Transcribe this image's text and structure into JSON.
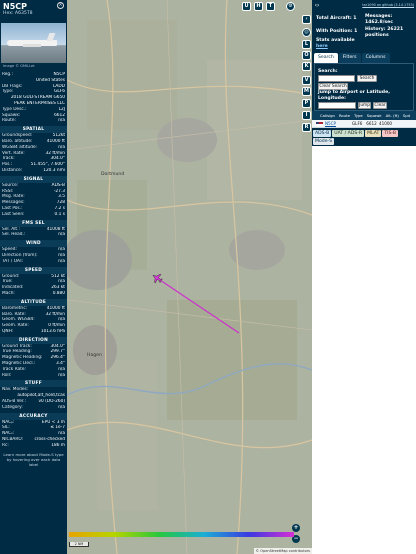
{
  "aircraft": {
    "callsign": "N5CP",
    "hex_label": "Hex: A635T8",
    "photo_credit": "Image © GMILLet"
  },
  "details": [
    {
      "k": "Reg.:",
      "v": "N5CP"
    },
    {
      "k": "",
      "v": "United States"
    },
    {
      "k": "DB Flags:",
      "v": "LADD"
    },
    {
      "k": "Type:",
      "v": "GLF6"
    },
    {
      "k": "",
      "v": "2018 GULFSTREAM G650"
    },
    {
      "k": "",
      "v": "PEAK ENTERPRISES LLC"
    },
    {
      "k": "Type Desc.:",
      "v": "L2J"
    },
    {
      "k": "Squawk:",
      "v": "6612"
    },
    {
      "k": "Route:",
      "v": "n/a"
    }
  ],
  "sections": {
    "spatial": {
      "title": "SPATIAL",
      "rows": [
        {
          "k": "Groundspeed:",
          "v": "512kt"
        },
        {
          "k": "Baro. altitude:",
          "v": "41000 ft"
        },
        {
          "k": "WGS84 altitude:",
          "v": "n/a"
        },
        {
          "k": "Vert. Rate:",
          "v": "32 ft/min"
        },
        {
          "k": "Track:",
          "v": "304.0°"
        },
        {
          "k": "Pos.:",
          "v": "51.455°, 7.600°"
        },
        {
          "k": "Distance:",
          "v": "120.3 nmi"
        }
      ]
    },
    "signal": {
      "title": "SIGNAL",
      "rows": [
        {
          "k": "Source:",
          "v": "ADS-B"
        },
        {
          "k": "RSSI:",
          "v": "-27.3"
        },
        {
          "k": "Msg. Rate:",
          "v": "3.5"
        },
        {
          "k": "Messages:",
          "v": "728"
        },
        {
          "k": "Last Pos.:",
          "v": "7.2 s"
        },
        {
          "k": "Last Seen:",
          "v": "0.1 s"
        }
      ]
    },
    "fms": {
      "title": "FMS SEL",
      "rows": [
        {
          "k": "Sel. Alt.:",
          "v": "41008 ft"
        },
        {
          "k": "Sel. Head.:",
          "v": "n/a"
        }
      ]
    },
    "wind": {
      "title": "WIND",
      "rows": [
        {
          "k": "Speed:",
          "v": "n/a"
        },
        {
          "k": "Direction (from):",
          "v": "n/a"
        },
        {
          "k": "TAT / OAT:",
          "v": "n/a"
        }
      ]
    },
    "speed": {
      "title": "SPEED",
      "rows": [
        {
          "k": "Ground:",
          "v": "512 kt"
        },
        {
          "k": "True:",
          "v": "n/a"
        },
        {
          "k": "Indicated:",
          "v": "263 kt"
        },
        {
          "k": "Mach:",
          "v": "0.880"
        }
      ]
    },
    "altitude": {
      "title": "ALTITUDE",
      "rows": [
        {
          "k": "Barometric:",
          "v": "41000 ft"
        },
        {
          "k": "Baro. Rate:",
          "v": "32 ft/min"
        },
        {
          "k": "Geom. WGS84:",
          "v": "n/a"
        },
        {
          "k": "Geom. Rate:",
          "v": "0 ft/min"
        },
        {
          "k": "QNH:",
          "v": "1013.6 hPa"
        }
      ]
    },
    "direction": {
      "title": "DIRECTION",
      "rows": [
        {
          "k": "Ground Track:",
          "v": "304.0°"
        },
        {
          "k": "True Heading:",
          "v": "299.7°"
        },
        {
          "k": "Magnetic Heading:",
          "v": "296.4°"
        },
        {
          "k": "Magnetic Decl.:",
          "v": "3.4°"
        },
        {
          "k": "Track Rate:",
          "v": "n/a"
        },
        {
          "k": "Roll:",
          "v": "n/a"
        }
      ]
    },
    "stuff": {
      "title": "STUFF",
      "rows": [
        {
          "k": "Nav. Modes:",
          "v": ""
        },
        {
          "k": "",
          "v": "autopilot,alt_hold,tcas"
        },
        {
          "k": "ADS-B Ver.:",
          "v": "v0 (DO-260)"
        },
        {
          "k": "Category:",
          "v": "n/a"
        }
      ]
    },
    "accuracy": {
      "title": "ACCURACY",
      "rows": [
        {
          "k": "NACₚ:",
          "v": "EPU < 3 m"
        },
        {
          "k": "SIL:",
          "v": "≤ 1e-7"
        },
        {
          "k": "NACᵥ:",
          "v": "n/a"
        },
        {
          "k": "NICBARO:",
          "v": "cross-checked"
        },
        {
          "k": "Rc:",
          "v": "186 m"
        }
      ]
    },
    "footer_note": "Learn more about Mode-S type by hovering over each data label"
  },
  "map": {
    "top_buttons": [
      "U",
      "H",
      "T"
    ],
    "side_buttons": [
      "L",
      "O",
      "K",
      "V",
      "M",
      "P",
      "I",
      "R"
    ],
    "scale_label": "2 NM",
    "attribution": "© OpenStreetMap contributors",
    "city_label": "Dortmund",
    "city_label_2": "Hagen",
    "track_color": "#cc33cc",
    "zoom_in": "+",
    "zoom_out": "−"
  },
  "right": {
    "github_link": "tar1090 on github (3.14.1753)",
    "total_aircraft": "Total Aircraft: 1",
    "messages": "Messages: 1462.8/sec",
    "with_position": "With Position: 1",
    "history": "History: 26221 positions",
    "stats_available": "Stats available",
    "stats_here": "here",
    "tabs": [
      "Search",
      "Filters",
      "Columns"
    ],
    "search_label": "Search:",
    "search_button": "Search",
    "clear_search": "Clear Search",
    "jump_label": "Jump to Airport or Latitude, Longitude:",
    "jump_button": "Jump",
    "clear_button": "Clear",
    "columns": [
      "Callsign",
      "Route",
      "Type",
      "Squawk",
      "Alt. (ft)",
      "Spd"
    ],
    "row": {
      "callsign": "N5CP",
      "type": "GLF6",
      "squawk": "6612",
      "alt": "41000"
    },
    "legend": [
      "ADS-B",
      "UAT / ADS-R",
      "MLAT",
      "TIS-B",
      "Mode-S"
    ]
  }
}
